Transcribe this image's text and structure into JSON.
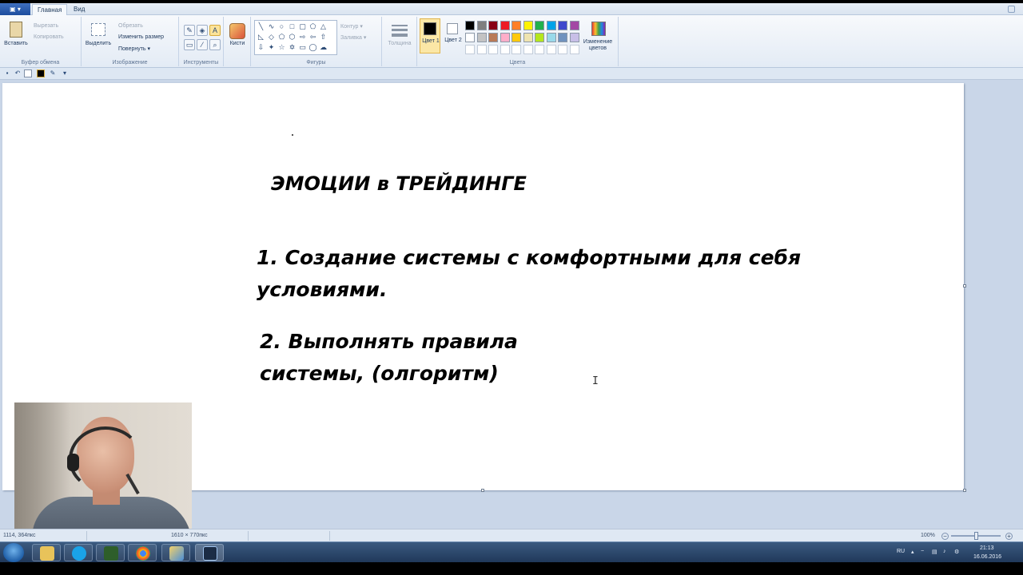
{
  "menu": {
    "app_button": "▣ ▾",
    "tabs": [
      "Главная",
      "Вид"
    ]
  },
  "ribbon": {
    "clipboard": {
      "paste": "Вставить",
      "cut": "Вырезать",
      "copy": "Копировать",
      "group": "Буфер обмена"
    },
    "image": {
      "select": "Выделить",
      "crop": "Обрезать",
      "resize": "Изменить размер",
      "rotate": "Повернуть ▾",
      "group": "Изображение"
    },
    "tools": {
      "group": "Инструменты"
    },
    "brushes": {
      "label": "Кисти"
    },
    "shapes": {
      "outline": "Контур ▾",
      "fill": "Заливка ▾",
      "group": "Фигуры"
    },
    "size": {
      "label": "Толщина"
    },
    "colors": {
      "color1": "Цвет 1",
      "color2": "Цвет 2",
      "edit": "Изменение цветов",
      "group": "Цвета",
      "palette_row1": [
        "#000000",
        "#7f7f7f",
        "#880015",
        "#ed1c24",
        "#ff7f27",
        "#fff200",
        "#22b14c",
        "#00a2e8",
        "#3f48cc",
        "#a349a4"
      ],
      "palette_row2": [
        "#ffffff",
        "#c3c3c3",
        "#b97a57",
        "#ffaec9",
        "#ffc90e",
        "#efe4b0",
        "#b5e61d",
        "#99d9ea",
        "#7092be",
        "#c8bfe7"
      ]
    }
  },
  "document": {
    "title": "ЭМОЦИИ в ТРЕЙДИНГЕ",
    "item1_line1": "1. Создание системы с комфортными для себя",
    "item1_line2": "условиями.",
    "item2_line1": "2. Выполнять правила",
    "item2_line2": "системы, (олгоритм)"
  },
  "status": {
    "cursor_pos": "1114, 364пкс",
    "canvas_size": "1610 × 770пкс",
    "zoom": "100%"
  },
  "taskbar": {
    "lang": "RU",
    "time": "21:13",
    "date": "16.06.2016"
  }
}
